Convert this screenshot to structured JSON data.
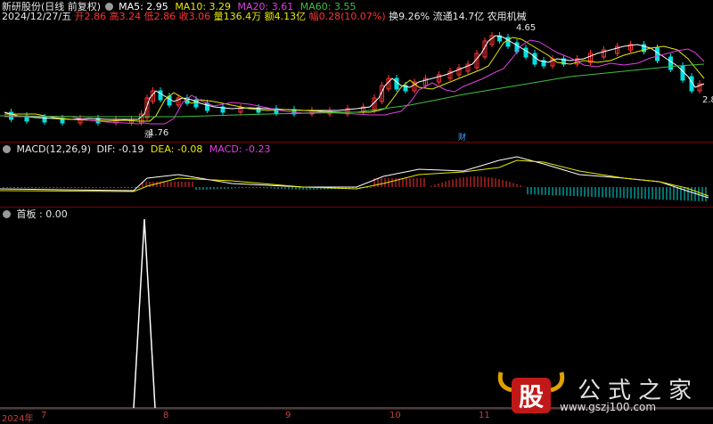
{
  "header": {
    "stock_name": "新研股份(日线 前复权)",
    "ma5": "MA5: 2.95",
    "ma10": "MA10: 3.29",
    "ma20": "MA20: 3.61",
    "ma60": "MA60: 3.55",
    "date": "2024/12/27/五",
    "open": "开2.86",
    "high": "高3.24",
    "low": "低2.86",
    "close": "收3.06",
    "volume": "量136.4万",
    "amount": "额4.13亿",
    "change": "幅0.28(10.07%)",
    "turnover": "换9.26%",
    "float": "流通14.7亿",
    "sector": "农用机械"
  },
  "price_chart": {
    "high_label": "4.65",
    "low_label": "1.76",
    "right_label": "2.8",
    "event_marker_1": "涨",
    "event_marker_2": "财"
  },
  "macd": {
    "title": "MACD(12,26,9)",
    "dif": "DIF: -0.19",
    "dea": "DEA: -0.08",
    "macd": "MACD: -0.23"
  },
  "indicator": {
    "title": "首板 : 0.00"
  },
  "dates": {
    "year": "2024年",
    "m7": "7",
    "m8": "8",
    "m9": "9",
    "m10": "10",
    "m11": "11"
  },
  "watermark": {
    "logo_text": "股",
    "text": "公式之家",
    "url": "www.gszj100.com"
  },
  "colors": {
    "ma5": "#ffffff",
    "ma10": "#e8e800",
    "ma20": "#e040e0",
    "ma60": "#40c040",
    "up": "#ff3232",
    "down": "#00e0e0",
    "separator": "#7a0000"
  }
}
